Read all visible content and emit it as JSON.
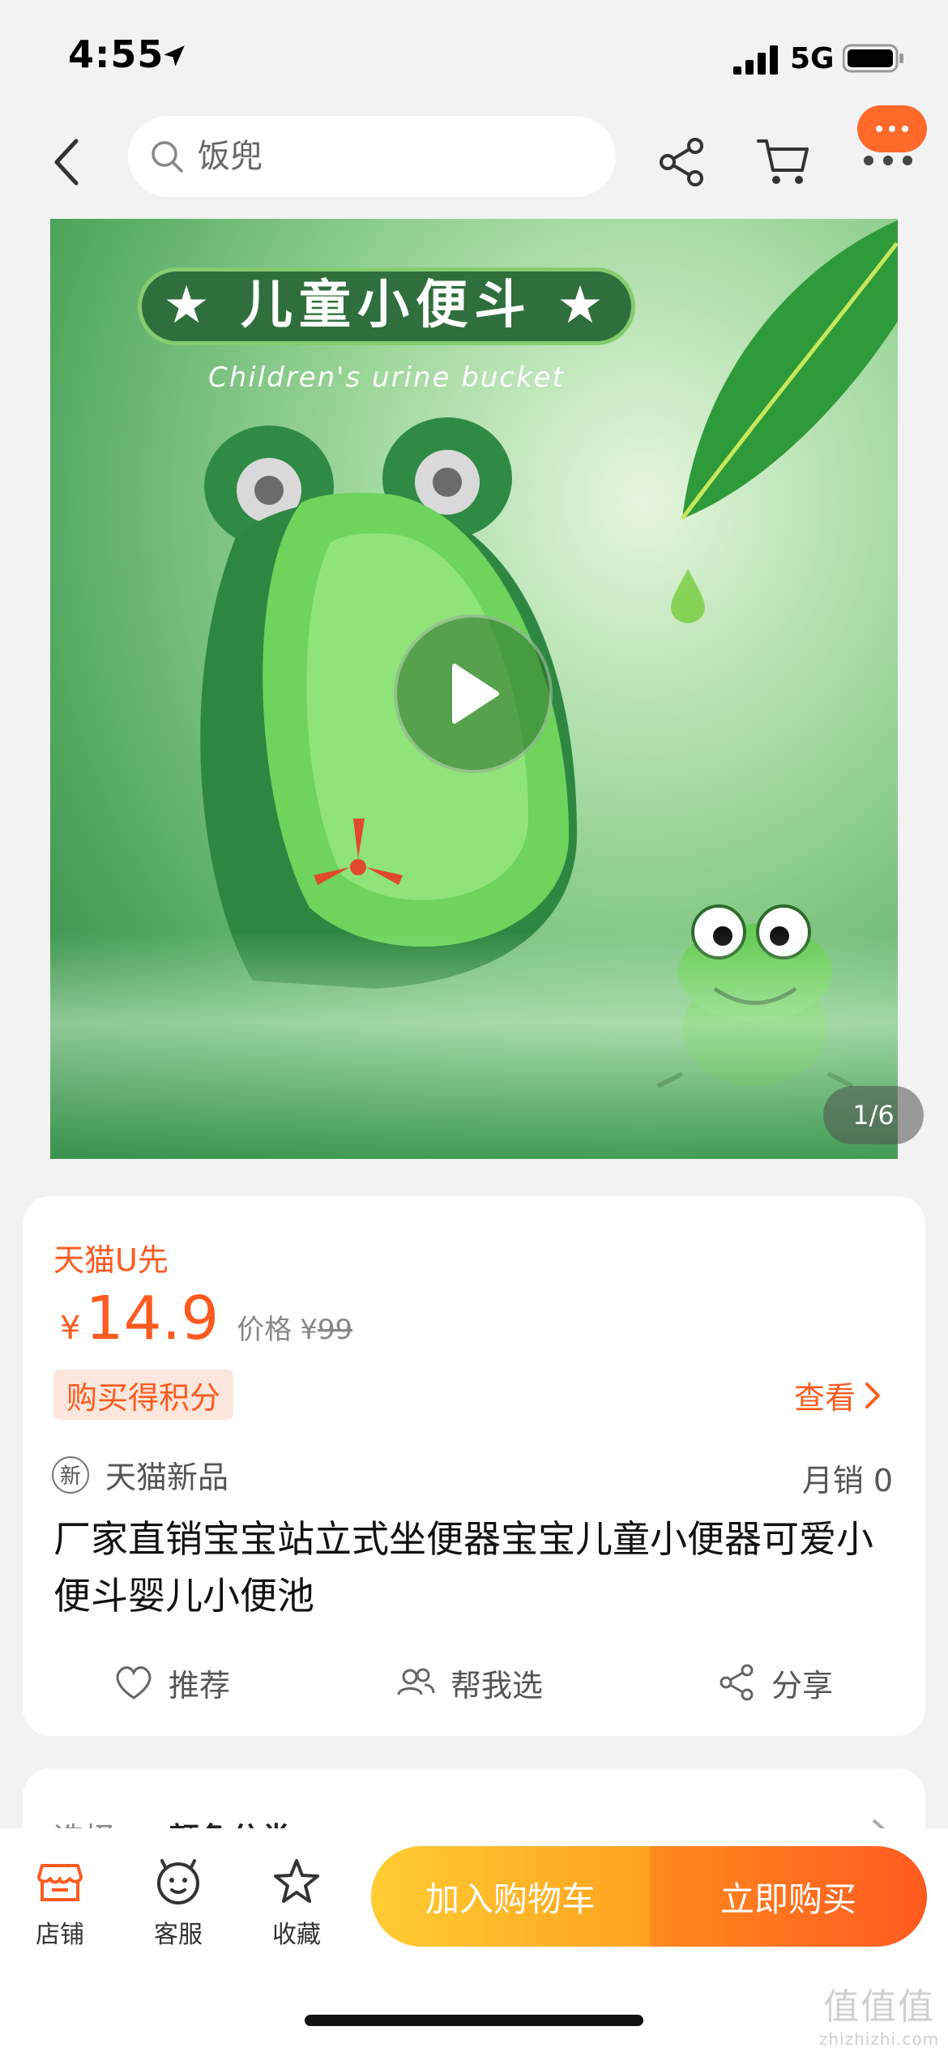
{
  "status_bar": {
    "time": "4:55",
    "network": "5G"
  },
  "nav": {
    "search_placeholder": "饭兜"
  },
  "hero": {
    "banner_text": "★ 儿童小便斗 ★",
    "subtitle": "Children's urine bucket",
    "image_counter": "1/6"
  },
  "product": {
    "promo_label": "天猫U先",
    "price_currency": "¥",
    "price": "14.9",
    "original_label": "价格",
    "original_currency": "¥",
    "original_price": "99",
    "points_badge": "购买得积分",
    "check_link": "查看",
    "new_badge_char": "新",
    "new_label": "天猫新品",
    "monthly_sales": "月销 0",
    "title": "厂家直销宝宝站立式坐便器宝宝儿童小便器可爱小便斗婴儿小便池",
    "actions": {
      "recommend": "推荐",
      "help_choose": "帮我选",
      "share": "分享"
    }
  },
  "selection": {
    "label": "选择",
    "value": "颜色分类"
  },
  "bottom_bar": {
    "tabs": {
      "store": "店铺",
      "service": "客服",
      "favorite": "收藏"
    },
    "add_to_cart": "加入购物车",
    "buy_now": "立即购买"
  },
  "watermark": {
    "big": "值值值",
    "small": "zhizhizhi.com"
  },
  "colors": {
    "accent": "#ff5a1f",
    "cart_button": "#ffb01e",
    "buy_button": "#ff6a1e"
  }
}
